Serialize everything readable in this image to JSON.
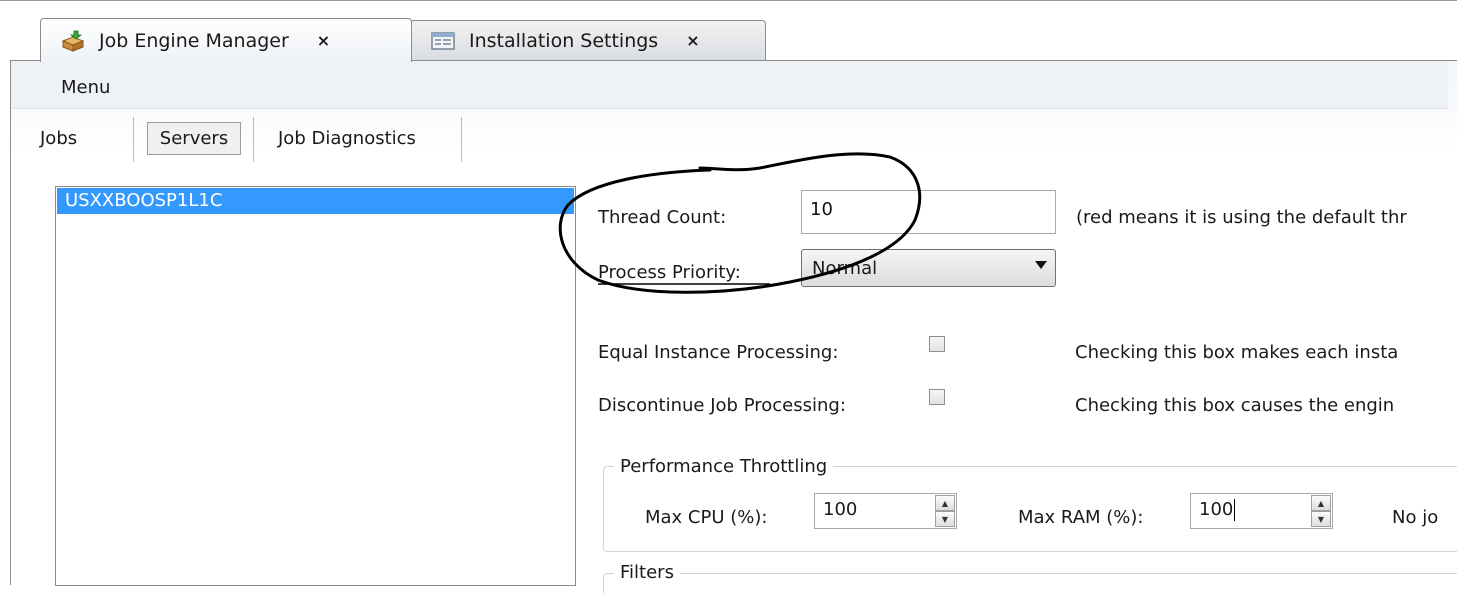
{
  "tabs": [
    {
      "label": "Job Engine Manager",
      "icon": "package-icon",
      "close": "×"
    },
    {
      "label": "Installation Settings",
      "icon": "settings-window-icon",
      "close": "×"
    }
  ],
  "menu": {
    "label": "Menu"
  },
  "subtabs": {
    "jobs": "Jobs",
    "servers": "Servers",
    "diagnostics": "Job Diagnostics"
  },
  "servers": [
    {
      "name": "USXXBOOSP1L1C",
      "selected": true
    }
  ],
  "settings": {
    "thread_count_label": "Thread Count:",
    "thread_count_value": "10",
    "thread_count_hint": "(red means it is using the default thr",
    "process_priority_label": "Process Priority:",
    "process_priority_value": "Normal",
    "equal_instance_label": "Equal Instance Processing:",
    "equal_instance_hint": "Checking this box makes each insta",
    "discontinue_label": "Discontinue Job Processing:",
    "discontinue_hint": "Checking this box causes the engin"
  },
  "throttling": {
    "title": "Performance Throttling",
    "max_cpu_label": "Max CPU (%):",
    "max_cpu_value": "100",
    "max_ram_label": "Max RAM (%):",
    "max_ram_value": "100",
    "note": "No jo"
  },
  "filters": {
    "title": "Filters"
  },
  "colors": {
    "selection": "#3399ff",
    "annotation": "#000000"
  }
}
